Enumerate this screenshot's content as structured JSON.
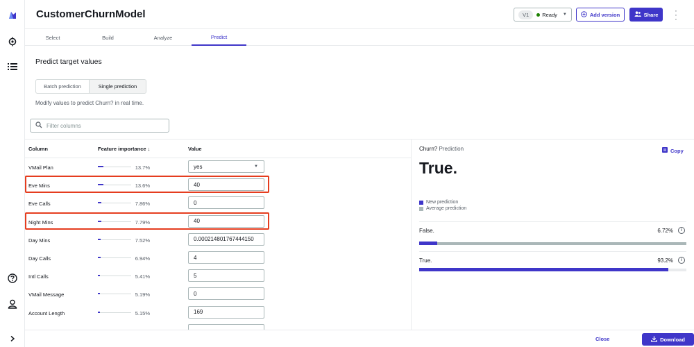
{
  "header": {
    "title": "CustomerChurnModel",
    "version_badge": "V1",
    "status": "Ready",
    "add_version_label": "Add version",
    "share_label": "Share"
  },
  "tabs": [
    {
      "label": "Select",
      "active": false
    },
    {
      "label": "Build",
      "active": false
    },
    {
      "label": "Analyze",
      "active": false
    },
    {
      "label": "Predict",
      "active": true
    }
  ],
  "main": {
    "section_title": "Predict target values",
    "segments": [
      {
        "label": "Batch prediction",
        "active": false
      },
      {
        "label": "Single prediction",
        "active": true
      }
    ],
    "hint": "Modify values to predict Churn? in real time.",
    "filter_placeholder": "Filter columns"
  },
  "table": {
    "headers": {
      "column": "Column",
      "importance": "Feature importance ↓",
      "value": "Value"
    },
    "rows": [
      {
        "name": "VMail Plan",
        "importance_pct": "13.7%",
        "importance": 13.7,
        "value": "yes",
        "type": "select",
        "highlighted": false
      },
      {
        "name": "Eve Mins",
        "importance_pct": "13.6%",
        "importance": 13.6,
        "value": "40",
        "type": "input",
        "highlighted": true
      },
      {
        "name": "Eve Calls",
        "importance_pct": "7.86%",
        "importance": 7.86,
        "value": "0",
        "type": "input",
        "highlighted": false
      },
      {
        "name": "Night Mins",
        "importance_pct": "7.79%",
        "importance": 7.79,
        "value": "40",
        "type": "input",
        "highlighted": true
      },
      {
        "name": "Day Mins",
        "importance_pct": "7.52%",
        "importance": 7.52,
        "value": "0.000214801767444150",
        "type": "input",
        "highlighted": false
      },
      {
        "name": "Day Calls",
        "importance_pct": "6.94%",
        "importance": 6.94,
        "value": "4",
        "type": "input",
        "highlighted": false
      },
      {
        "name": "Intl Calls",
        "importance_pct": "5.41%",
        "importance": 5.41,
        "value": "5",
        "type": "input",
        "highlighted": false
      },
      {
        "name": "VMail Message",
        "importance_pct": "5.19%",
        "importance": 5.19,
        "value": "0",
        "type": "input",
        "highlighted": false
      },
      {
        "name": "Account Length",
        "importance_pct": "5.15%",
        "importance": 5.15,
        "value": "169",
        "type": "input",
        "highlighted": false
      },
      {
        "name": "",
        "importance_pct": "",
        "importance": 0,
        "value": "",
        "type": "input",
        "highlighted": false
      }
    ]
  },
  "prediction": {
    "label_target": "Churn?",
    "label_suffix": " Prediction",
    "copy_label": "Copy",
    "result": "True.",
    "legend": [
      {
        "label": "New prediction",
        "color": "#3f36c9"
      },
      {
        "label": "Average prediction",
        "color": "#aab7b8"
      }
    ],
    "results": [
      {
        "name": "False.",
        "pct_label": "6.72%",
        "pct": 6.72
      },
      {
        "name": "True.",
        "pct_label": "93.2%",
        "pct": 93.2
      }
    ]
  },
  "footer": {
    "close_label": "Close",
    "download_label": "Download"
  },
  "colors": {
    "accent": "#3f36c9",
    "highlight": "#e53d1f",
    "success": "#1d8102"
  }
}
